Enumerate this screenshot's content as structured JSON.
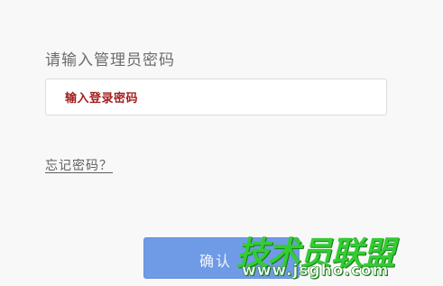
{
  "login": {
    "prompt_label": "请输入管理员密码",
    "password_placeholder": "输入登录密码",
    "password_value": "",
    "forgot_link": "忘记密码？",
    "confirm_label": "确认"
  },
  "watermark": {
    "title": "技术员联盟",
    "url": "www.jsgho.com"
  },
  "colors": {
    "background": "#f8f8f8",
    "placeholder_text": "#a31f1f",
    "button_background": "#6e9ae6",
    "watermark_green": "#33cc33"
  }
}
